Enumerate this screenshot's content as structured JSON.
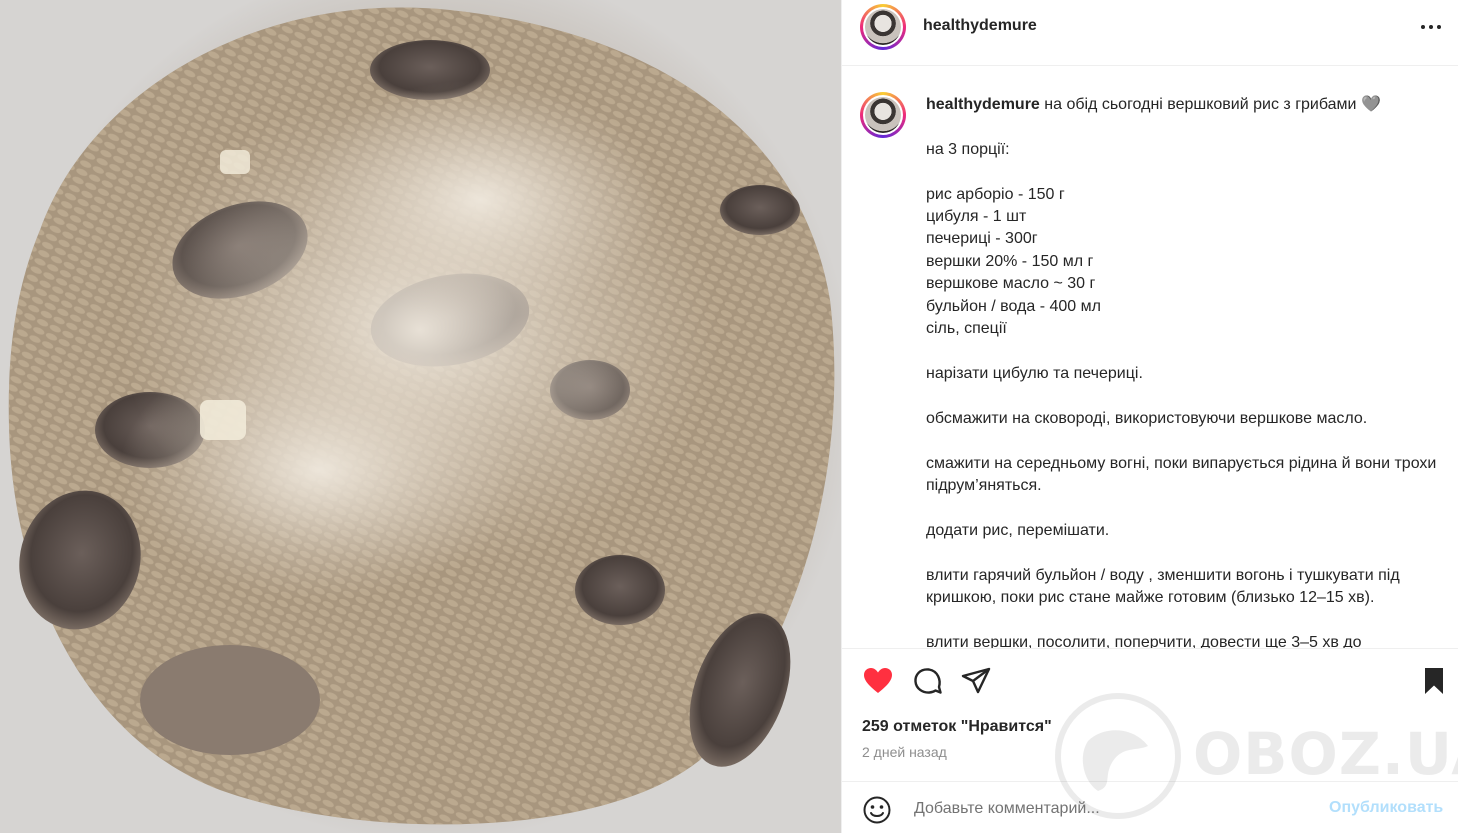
{
  "post": {
    "username": "healthydemure",
    "caption_username": "healthydemure",
    "caption_body": " на обід сьогодні вершковий рис з грибами 🩶\n\nна 3 порції:\n\nрис арборіо - 150 г\nцибуля - 1 шт\nпечериці - 300г\nвершки 20% - 150 мл г\nвершкове масло ~ 30 г\nбульйон / вода - 400 мл\nсіль, спеції\n\nнарізати цибулю та печериці.\n\nобсмажити на сковороді, використовуючи вершкове масло.\n\nсмажити на середньому вогні, поки випарується рідина й вони трохи підрум’яняться.\n\nдодати рис, перемішати.\n\nвлити гарячий бульйон / воду , зменшити вогонь і тушкувати під кришкою, поки рис стане майже готовим (близько 12–15 хв).\n\nвлити вершки, посолити, поперчити, довести ще 3–5 хв до"
  },
  "actions": {
    "likes": "259 отметок \"Нравится\"",
    "time_ago": "2 дней назад",
    "like_icon": "heart-filled-icon",
    "comment_icon": "comment-icon",
    "share_icon": "share-icon",
    "save_icon": "bookmark-icon"
  },
  "comment": {
    "placeholder": "Добавьте комментарий...",
    "publish_label": "Опубликовать"
  },
  "watermark": {
    "text": "OBOZ.UA"
  },
  "colors": {
    "like": "#ff3040",
    "publish_disabled": "#b2dffc",
    "muted": "#8e8e8e",
    "text": "#262626"
  }
}
